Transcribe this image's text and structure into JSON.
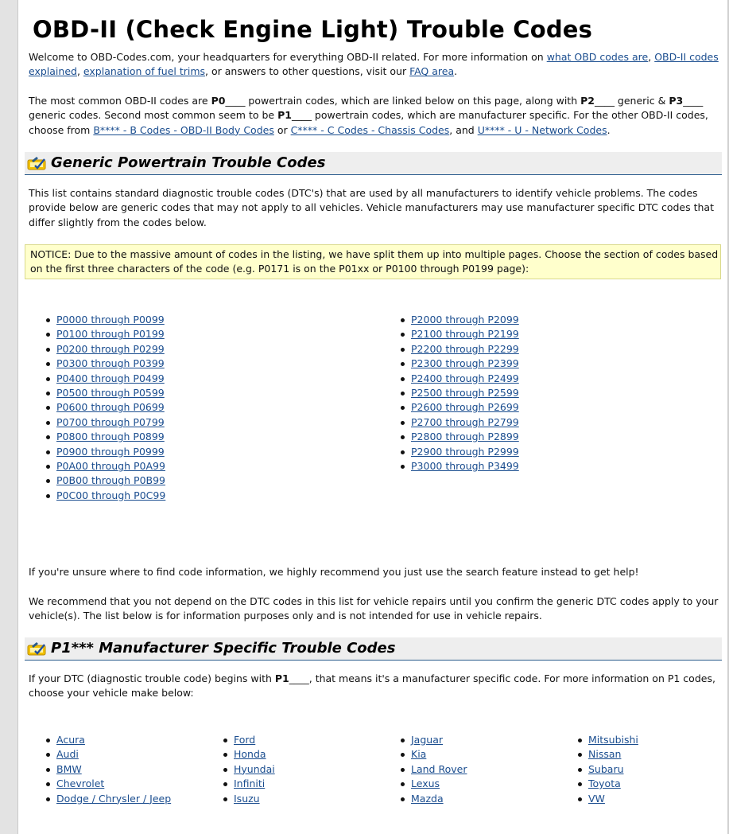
{
  "title": "OBD-II (Check Engine Light) Trouble Codes",
  "intro": {
    "t1": "Welcome to OBD-Codes.com, your headquarters for everything OBD-II related. For more information on ",
    "link1": "what OBD codes are",
    "t2": ", ",
    "link2": "OBD-II codes explained",
    "t3": ", ",
    "link3": "explanation of fuel trims",
    "t4": ", or answers to other questions, visit our ",
    "link4": "FAQ area",
    "t5": "."
  },
  "common": {
    "t1": "The most common OBD-II codes are ",
    "b1": "P0",
    "t2": "____ powertrain codes, which are linked below on this page, along with ",
    "b2": "P2",
    "t3": "____ generic & ",
    "b3": "P3",
    "t4": "____ generic codes. Second most common seem to be ",
    "b4": "P1",
    "t5": "____ powertrain codes, which are manufacturer specific. For the other OBD-II codes, choose from ",
    "link1": "B**** - B Codes - OBD-II Body Codes",
    "t6": " or ",
    "link2": "C**** - C Codes - Chassis Codes",
    "t7": ", and ",
    "link3": "U**** - U - Network Codes",
    "t8": "."
  },
  "generic_section": {
    "heading": "Generic Powertrain Trouble Codes",
    "description": "This list contains standard diagnostic trouble codes (DTC's) that are used by all manufacturers to identify vehicle problems. The codes provide below are generic codes that may not apply to all vehicles. Vehicle manufacturers may use manufacturer specific DTC codes that differ slightly from the codes below.",
    "notice": "NOTICE: Due to the massive amount of codes in the listing, we have split them up into multiple pages. Choose the section of codes based on the first three characters of the code (e.g. P0171 is on the P01xx or P0100 through P0199 page):",
    "left_links": [
      "P0000 through P0099",
      "P0100 through P0199",
      "P0200 through P0299",
      "P0300 through P0399",
      "P0400 through P0499",
      "P0500 through P0599",
      "P0600 through P0699",
      "P0700 through P0799",
      "P0800 through P0899",
      "P0900 through P0999",
      "P0A00 through P0A99",
      "P0B00 through P0B99",
      "P0C00 through P0C99"
    ],
    "right_links": [
      "P2000 through P2099",
      "P2100 through P2199",
      "P2200 through P2299",
      "P2300 through P2399",
      "P2400 through P2499",
      "P2500 through P2599",
      "P2600 through P2699",
      "P2700 through P2799",
      "P2800 through P2899",
      "P2900 through P2999",
      "P3000 through P3499"
    ],
    "search_note": "If you're unsure where to find code information, we highly recommend you just use the search feature instead to get help!",
    "disclaimer": "We recommend that you not depend on the DTC codes in this list for vehicle repairs until you confirm the generic DTC codes apply to your vehicle(s). The list below is for information purposes only and is not intended for use in vehicle repairs."
  },
  "manufacturer_section": {
    "heading": "P1*** Manufacturer Specific Trouble Codes",
    "t1": "If your DTC (diagnostic trouble code) begins with ",
    "b1": "P1",
    "t2": "____, that means it's a manufacturer specific code. For more information on P1 codes, choose your vehicle make below:",
    "col1": [
      "Acura",
      "Audi",
      "BMW",
      "Chevrolet",
      "Dodge / Chrysler / Jeep"
    ],
    "col2": [
      "Ford",
      "Honda",
      "Hyundai",
      "Infiniti",
      "Isuzu"
    ],
    "col3": [
      "Jaguar",
      "Kia",
      "Land Rover",
      "Lexus",
      "Mazda"
    ],
    "col4": [
      "Mitsubishi",
      "Nissan",
      "Subaru",
      "Toyota",
      "VW"
    ]
  },
  "colors": {
    "link": "#1a4d8f",
    "notice_bg": "#ffffcc",
    "heading_bg": "#eeeeee",
    "heading_rule": "#2a5b8c"
  },
  "icons": {
    "section_icon": "wrench-check-icon"
  }
}
